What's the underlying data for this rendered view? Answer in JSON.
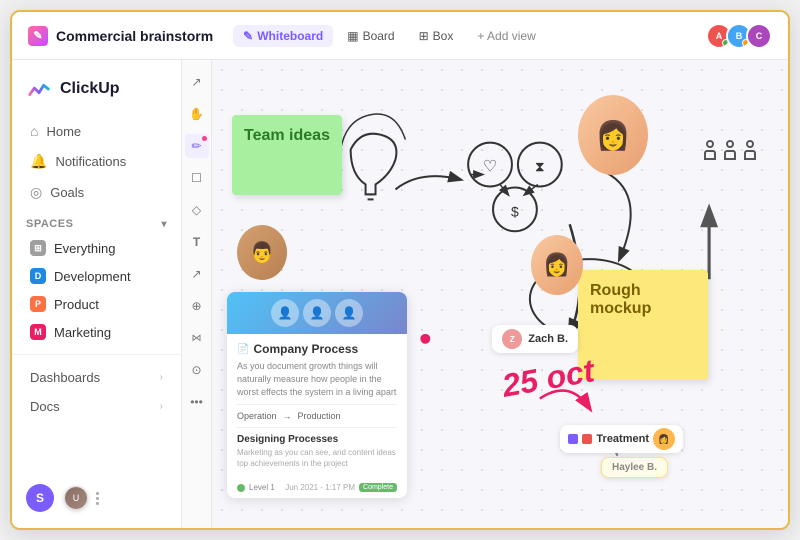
{
  "app": {
    "name": "ClickUp"
  },
  "header": {
    "project_icon": "✎",
    "project_name": "Commercial brainstorm",
    "views": [
      {
        "label": "Whiteboard",
        "active": true,
        "icon": "✎"
      },
      {
        "label": "Board",
        "active": false,
        "icon": "▦"
      },
      {
        "label": "Box",
        "active": false,
        "icon": "⊞"
      }
    ],
    "add_view_label": "+ Add view"
  },
  "sidebar": {
    "nav_items": [
      {
        "label": "Home",
        "icon": "⌂"
      },
      {
        "label": "Notifications",
        "icon": "🔔"
      },
      {
        "label": "Goals",
        "icon": "◎"
      }
    ],
    "spaces_label": "Spaces",
    "spaces": [
      {
        "label": "Everything",
        "color": "gray",
        "letter": ""
      },
      {
        "label": "Development",
        "color": "blue",
        "letter": "D"
      },
      {
        "label": "Product",
        "color": "orange",
        "letter": "P"
      },
      {
        "label": "Marketing",
        "color": "pink",
        "letter": "M"
      }
    ],
    "bottom_items": [
      {
        "label": "Dashboards",
        "has_arrow": true
      },
      {
        "label": "Docs",
        "has_arrow": true
      }
    ],
    "user_initial": "S"
  },
  "canvas": {
    "sticky_green_text": "Team ideas",
    "sticky_yellow_text": "Rough mockup",
    "card_title": "Company Process",
    "card_subtitle": "Designing Processes",
    "card_text": "As you document growth things will naturally measure how people in the worst effects the system in a living apart",
    "card_row_left": "Operation",
    "card_row_right": "Production",
    "zach_label": "Zach B.",
    "haylee_label": "Haylee B.",
    "treatment_label": "Treatment",
    "date_text": "25 oct",
    "people_icons_label": "group"
  },
  "tools": [
    {
      "icon": "↗",
      "name": "select-tool"
    },
    {
      "icon": "✋",
      "name": "hand-tool"
    },
    {
      "icon": "✏",
      "name": "pen-tool",
      "has_dot": true
    },
    {
      "icon": "☐",
      "name": "shape-tool"
    },
    {
      "icon": "◇",
      "name": "diamond-tool"
    },
    {
      "icon": "T",
      "name": "text-tool"
    },
    {
      "icon": "↗",
      "name": "connector-tool"
    },
    {
      "icon": "⊕",
      "name": "emoji-tool"
    },
    {
      "icon": "⋈",
      "name": "graph-tool"
    },
    {
      "icon": "⊙",
      "name": "globe-tool"
    },
    {
      "icon": "⋯",
      "name": "more-tool"
    }
  ]
}
